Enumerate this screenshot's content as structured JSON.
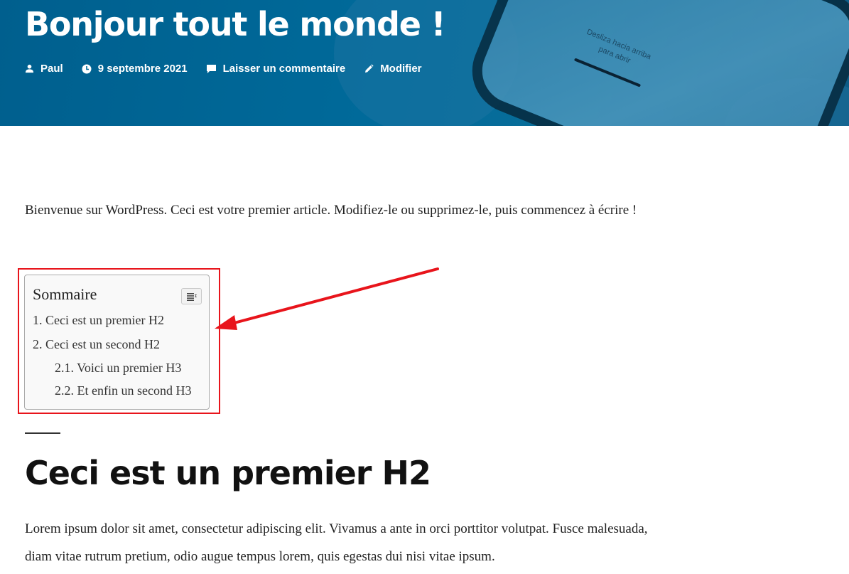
{
  "post": {
    "title": "Bonjour tout le monde !",
    "meta": {
      "author": "Paul",
      "date": "9 septembre 2021",
      "comment": "Laisser un commentaire",
      "edit": "Modifier"
    },
    "intro": "Bienvenue sur WordPress. Ceci est votre premier article. Modifiez-le ou supprimez-le, puis commencez à écrire !"
  },
  "hero_image": {
    "phone_text_line1": "Desliza hacia arriba",
    "phone_text_line2": "para abrir"
  },
  "toc": {
    "title": "Sommaire",
    "items": [
      {
        "label": "1. Ceci est un premier H2"
      },
      {
        "label": "2. Ceci est un second H2"
      },
      {
        "label": "2.1. Voici un premier H3"
      },
      {
        "label": "2.2. Et enfin un second H3"
      }
    ]
  },
  "section": {
    "heading": "Ceci est un premier H2",
    "paragraph": "Lorem ipsum dolor sit amet, consectetur adipiscing elit. Vivamus a ante in orci porttitor volutpat. Fusce malesuada, diam vitae rutrum pretium, odio augue tempus lorem, quis egestas dui nisi vitae ipsum."
  },
  "colors": {
    "hero_bg": "#006a9a",
    "annotation": "#e8141b"
  },
  "icons": [
    "user-icon",
    "clock-icon",
    "comment-icon",
    "pencil-icon",
    "toc-toggle-icon",
    "annotation-arrow"
  ]
}
